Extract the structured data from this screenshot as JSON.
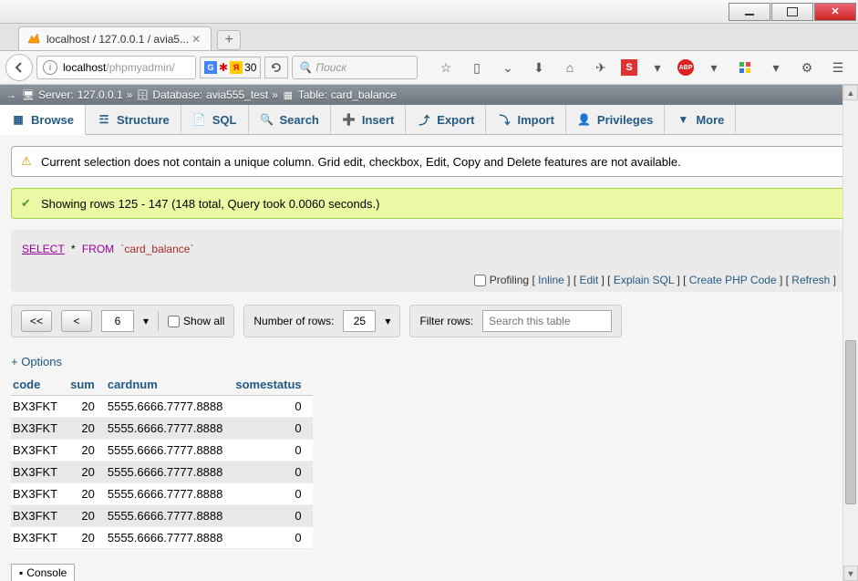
{
  "window": {
    "tab_title": "localhost / 127.0.0.1 / avia5...",
    "url_host": "localhost",
    "url_path": "/phpmyadmin/",
    "yandex_count": "30",
    "search_placeholder": "Поиск"
  },
  "breadcrumb": {
    "server_label": "Server:",
    "server_value": "127.0.0.1",
    "db_label": "Database:",
    "db_value": "avia555_test",
    "table_label": "Table:",
    "table_value": "card_balance",
    "sep": "»"
  },
  "tabs": {
    "browse": "Browse",
    "structure": "Structure",
    "sql": "SQL",
    "search": "Search",
    "insert": "Insert",
    "export": "Export",
    "import": "Import",
    "privileges": "Privileges",
    "more": "More"
  },
  "notices": {
    "warn": "Current selection does not contain a unique column. Grid edit, checkbox, Edit, Copy and Delete features are not available.",
    "success": "Showing rows 125 - 147 (148 total, Query took 0.0060 seconds.)"
  },
  "sql": {
    "select": "SELECT",
    "star": "*",
    "from": "FROM",
    "table": "`card_balance`",
    "profiling_label": "Profiling",
    "inline": "Inline",
    "edit": "Edit",
    "explain": "Explain SQL",
    "create_php": "Create PHP Code",
    "refresh": "Refresh"
  },
  "pager": {
    "first": "<<",
    "prev": "<",
    "page": "6",
    "show_all": "Show all",
    "num_rows_label": "Number of rows:",
    "num_rows": "25",
    "filter_label": "Filter rows:",
    "filter_placeholder": "Search this table"
  },
  "options": "+ Options",
  "columns": {
    "code": "code",
    "sum": "sum",
    "cardnum": "cardnum",
    "somestatus": "somestatus"
  },
  "rows": [
    {
      "code": "BX3FKT",
      "sum": "20",
      "cardnum": "5555.6666.7777.8888",
      "somestatus": "0"
    },
    {
      "code": "BX3FKT",
      "sum": "20",
      "cardnum": "5555.6666.7777.8888",
      "somestatus": "0"
    },
    {
      "code": "BX3FKT",
      "sum": "20",
      "cardnum": "5555.6666.7777.8888",
      "somestatus": "0"
    },
    {
      "code": "BX3FKT",
      "sum": "20",
      "cardnum": "5555.6666.7777.8888",
      "somestatus": "0"
    },
    {
      "code": "BX3FKT",
      "sum": "20",
      "cardnum": "5555.6666.7777.8888",
      "somestatus": "0"
    },
    {
      "code": "BX3FKT",
      "sum": "20",
      "cardnum": "5555.6666.7777.8888",
      "somestatus": "0"
    },
    {
      "code": "BX3FKT",
      "sum": "20",
      "cardnum": "5555.6666.7777.8888",
      "somestatus": "0"
    }
  ],
  "console": "Console"
}
